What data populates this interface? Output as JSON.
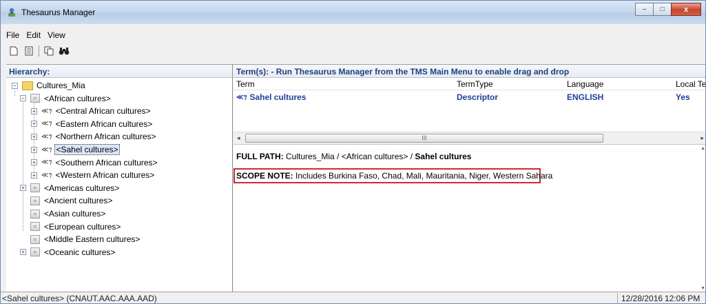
{
  "window": {
    "title": "Thesaurus Manager",
    "controls": {
      "minimize": "–",
      "maximize": "□",
      "close": "x"
    }
  },
  "menu": [
    "File",
    "Edit",
    "View"
  ],
  "toolbar": {
    "icons": [
      "new-icon",
      "properties-icon",
      "copy-icon",
      "find-icon"
    ],
    "glyphs": [
      "▯",
      "▤",
      "⧉",
      "♠"
    ]
  },
  "left": {
    "header": "Hierarchy:",
    "tree": [
      {
        "label": "Cultures_Mia",
        "kind": "folder",
        "exp": "−"
      },
      {
        "label": "<African cultures>",
        "kind": "guide",
        "exp": "−"
      },
      {
        "label": "<Central African cultures>",
        "kind": "descriptor",
        "exp": "+"
      },
      {
        "label": "<Eastern African cultures>",
        "kind": "descriptor",
        "exp": "+"
      },
      {
        "label": "<Northern African cultures>",
        "kind": "descriptor",
        "exp": "+"
      },
      {
        "label": "<Sahel cultures>",
        "kind": "descriptor",
        "exp": "+",
        "selected": true
      },
      {
        "label": "<Southern African cultures>",
        "kind": "descriptor",
        "exp": "+"
      },
      {
        "label": "<Western African cultures>",
        "kind": "descriptor",
        "exp": "+"
      },
      {
        "label": "<Americas cultures>",
        "kind": "guide",
        "exp": "+"
      },
      {
        "label": "<Ancient cultures>",
        "kind": "guide",
        "exp": ""
      },
      {
        "label": "<Asian cultures>",
        "kind": "guide",
        "exp": ""
      },
      {
        "label": "<European cultures>",
        "kind": "guide",
        "exp": ""
      },
      {
        "label": "<Middle Eastern cultures>",
        "kind": "guide",
        "exp": ""
      },
      {
        "label": "<Oceanic cultures>",
        "kind": "guide",
        "exp": "+"
      }
    ]
  },
  "right": {
    "header": "Term(s): - Run Thesaurus Manager from the TMS Main Menu to enable drag and drop",
    "columns": [
      "Term",
      "TermType",
      "Language",
      "Local Ter"
    ],
    "row": {
      "term": "Sahel cultures",
      "termtype": "Descriptor",
      "language": "ENGLISH",
      "local": "Yes"
    },
    "scroll_mark": "III",
    "full_path": {
      "label": "FULL PATH:",
      "path": "Cultures_Mia / <African cultures> /",
      "term": "Sahel cultures"
    },
    "scope_note": {
      "label": "SCOPE NOTE:",
      "text": "Includes Burkina Faso, Chad, Mali, Mauritania, Niger, Western Sahara"
    }
  },
  "status": {
    "left": "<Sahel cultures>   (CNAUT.AAC.AAA.AAD)",
    "date": "12/28/2016",
    "time": "12:06 PM"
  },
  "colors": {
    "accent": "#1d3fa8",
    "highlight_box": "#d8242a"
  }
}
